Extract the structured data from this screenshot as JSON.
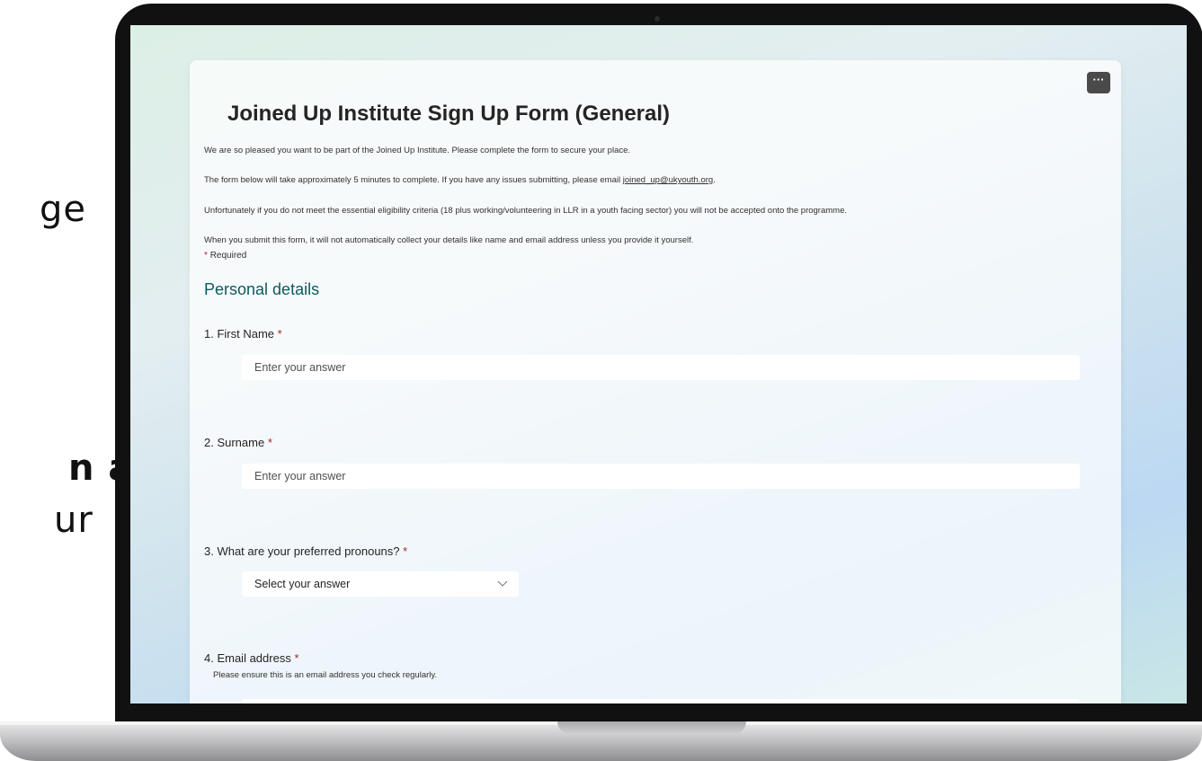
{
  "slide_fragments": [
    "ge",
    "n a",
    "ur"
  ],
  "form": {
    "more_label": "···",
    "title": "Joined Up Institute Sign Up Form (General)",
    "description": {
      "line1": "We are so pleased you want to be part of the Joined Up Institute. Please complete the form to secure your place.",
      "line2_prefix": "The form below will take approximately 5 minutes to complete. If you have any issues submitting, please email ",
      "line2_email": "joined_up@ukyouth.org",
      "line2_suffix": ".",
      "line3": "Unfortunately if you do not meet the essential eligibility criteria (18 plus working/volunteering in LLR in a youth facing sector) you will not be accepted onto the programme.",
      "line4": "When you submit this form, it will not automatically collect your details like name and email address unless you provide it yourself."
    },
    "required_note": "Required",
    "required_marker": "*",
    "section_title": "Personal details",
    "questions": [
      {
        "label": "1. First Name",
        "placeholder": "Enter your answer"
      },
      {
        "label": "2. Surname",
        "placeholder": "Enter your answer"
      },
      {
        "label": "3. What are your preferred pronouns?",
        "select_value": "Select your answer"
      },
      {
        "label": "4. Email address ",
        "subtitle": "Please ensure this is an email address you check regularly.",
        "placeholder": ""
      }
    ]
  },
  "colors": {
    "section_title": "#0b5a5f",
    "required": "#a4262c",
    "bezel": "#111111"
  },
  "icons": [
    "more-options-icon",
    "chevron-down-icon"
  ]
}
